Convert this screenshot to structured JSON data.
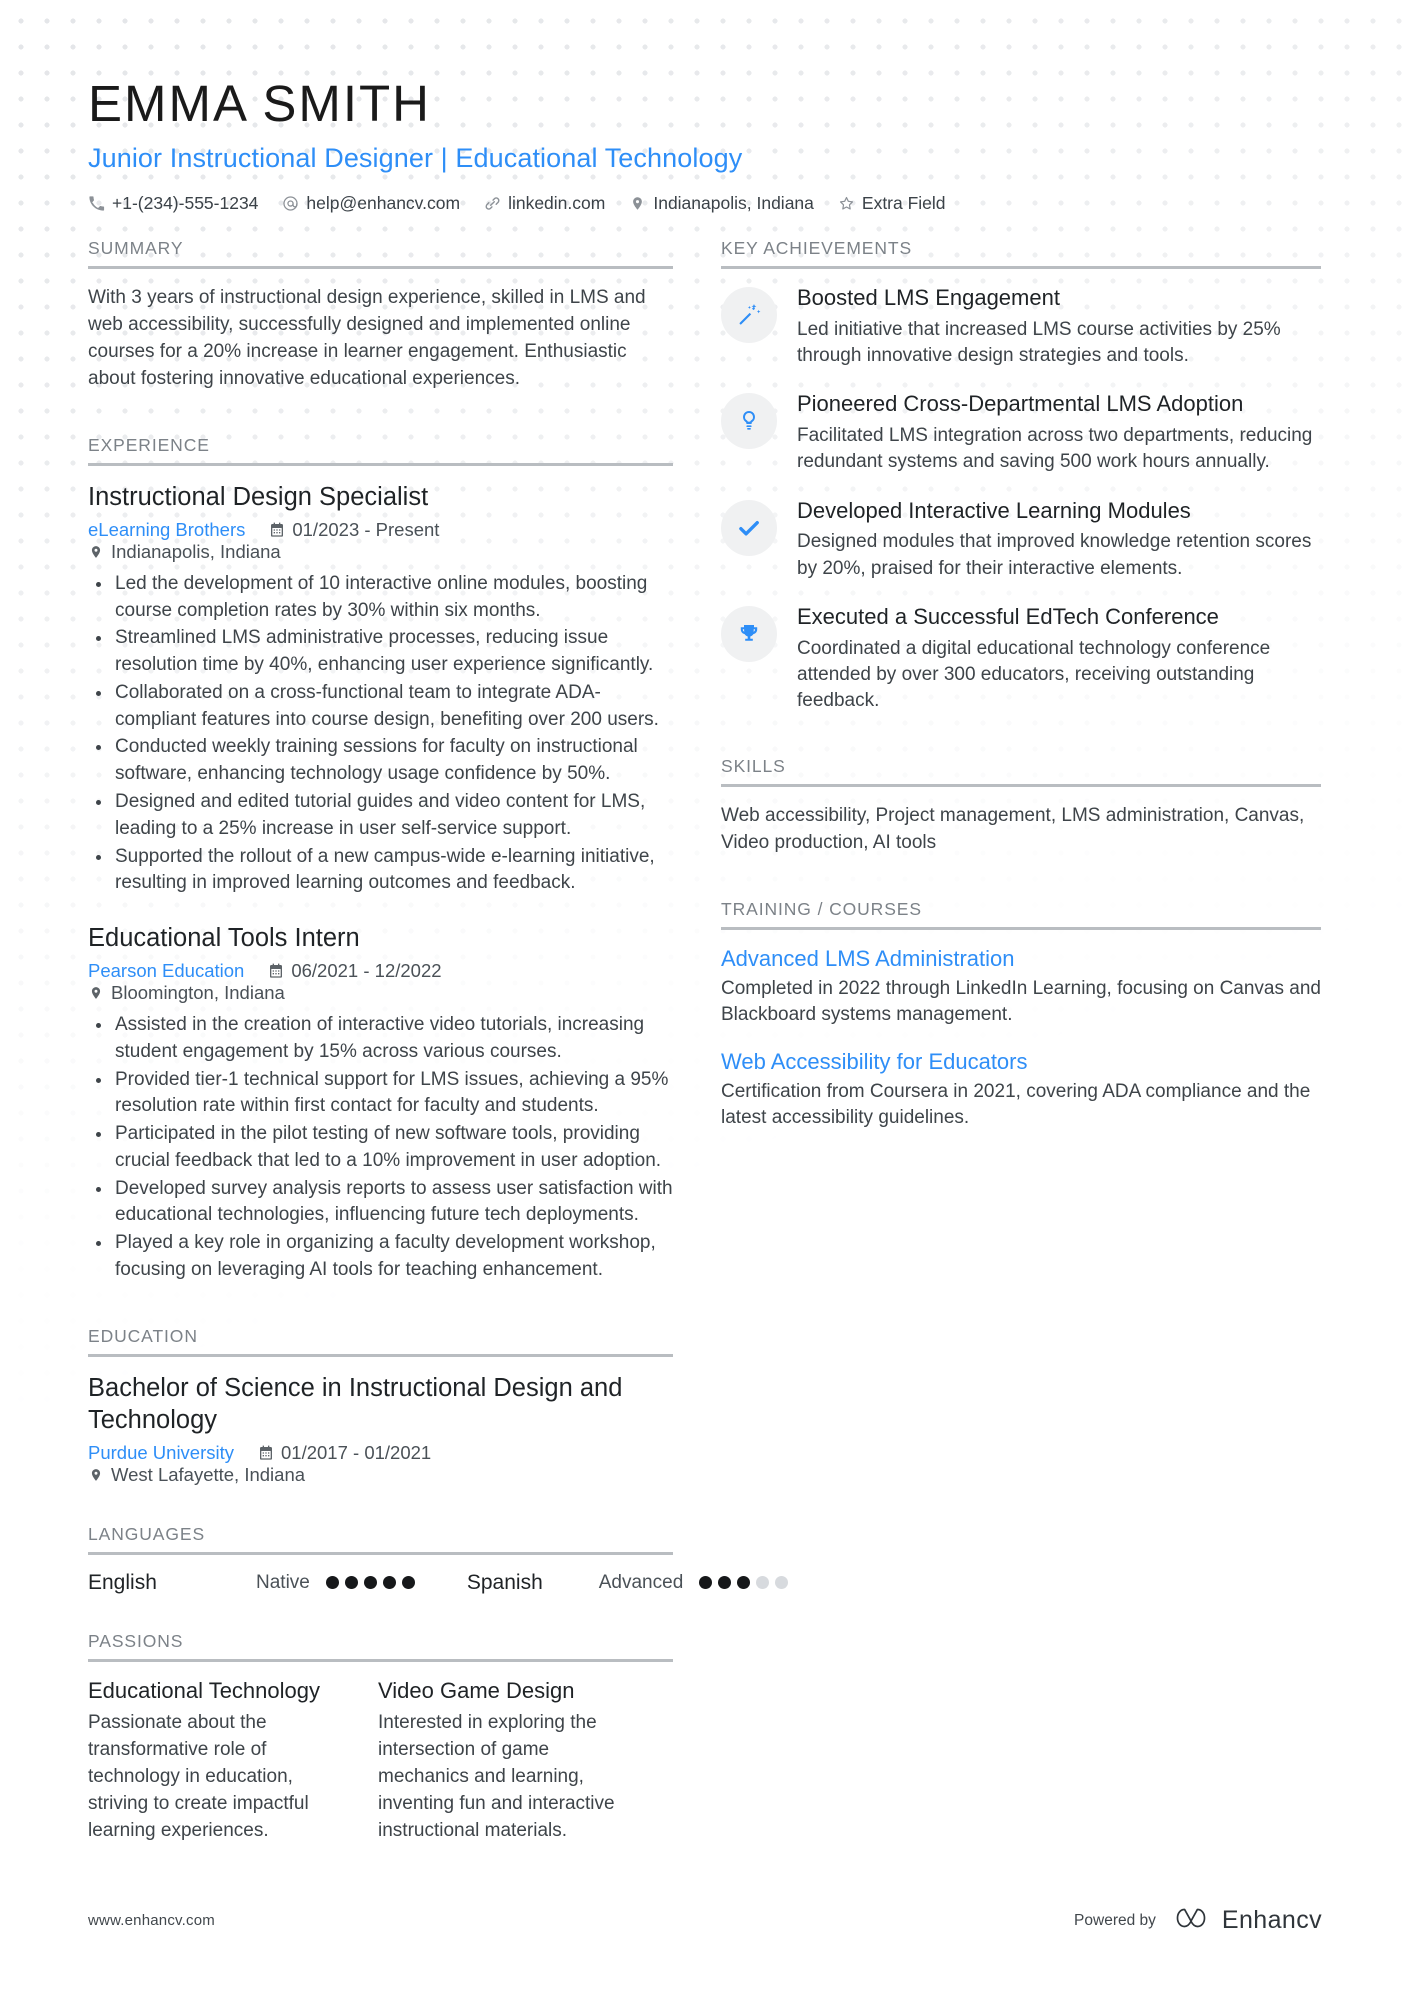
{
  "header": {
    "name": "EMMA SMITH",
    "headline": "Junior Instructional Designer | Educational Technology",
    "contacts": [
      {
        "icon": "phone-icon",
        "text": "+1-(234)-555-1234"
      },
      {
        "icon": "email-icon",
        "text": "help@enhancv.com"
      },
      {
        "icon": "link-icon",
        "text": "linkedin.com"
      },
      {
        "icon": "location-icon",
        "text": "Indianapolis, Indiana"
      },
      {
        "icon": "star-icon",
        "text": "Extra Field"
      }
    ]
  },
  "sections": {
    "summary": {
      "title": "SUMMARY",
      "text": "With 3 years of instructional design experience, skilled in LMS and web accessibility, successfully designed and implemented online courses for a 20% increase in learner engagement. Enthusiastic about fostering innovative educational experiences."
    },
    "experience": {
      "title": "EXPERIENCE",
      "entries": [
        {
          "role": "Instructional Design Specialist",
          "org": "eLearning Brothers",
          "dates": "01/2023 - Present",
          "location": "Indianapolis, Indiana",
          "bullets": [
            "Led the development of 10 interactive online modules, boosting course completion rates by 30% within six months.",
            "Streamlined LMS administrative processes, reducing issue resolution time by 40%, enhancing user experience significantly.",
            "Collaborated on a cross-functional team to integrate ADA-compliant features into course design, benefiting over 200 users.",
            "Conducted weekly training sessions for faculty on instructional software, enhancing technology usage confidence by 50%.",
            "Designed and edited tutorial guides and video content for LMS, leading to a 25% increase in user self-service support.",
            "Supported the rollout of a new campus-wide e-learning initiative, resulting in improved learning outcomes and feedback."
          ]
        },
        {
          "role": "Educational Tools Intern",
          "org": "Pearson Education",
          "dates": "06/2021 - 12/2022",
          "location": "Bloomington, Indiana",
          "bullets": [
            "Assisted in the creation of interactive video tutorials, increasing student engagement by 15% across various courses.",
            "Provided tier-1 technical support for LMS issues, achieving a 95% resolution rate within first contact for faculty and students.",
            "Participated in the pilot testing of new software tools, providing crucial feedback that led to a 10% improvement in user adoption.",
            "Developed survey analysis reports to assess user satisfaction with educational technologies, influencing future tech deployments.",
            "Played a key role in organizing a faculty development workshop, focusing on leveraging AI tools for teaching enhancement."
          ]
        }
      ]
    },
    "education": {
      "title": "EDUCATION",
      "entries": [
        {
          "degree": "Bachelor of Science in Instructional Design and Technology",
          "org": "Purdue University",
          "dates": "01/2017 - 01/2021",
          "location": "West Lafayette, Indiana"
        }
      ]
    },
    "languages": {
      "title": "LANGUAGES",
      "items": [
        {
          "name": "English",
          "level": "Native",
          "filled": 5,
          "total": 5
        },
        {
          "name": "Spanish",
          "level": "Advanced",
          "filled": 3,
          "total": 5
        }
      ]
    },
    "passions": {
      "title": "PASSIONS",
      "items": [
        {
          "name": "Educational Technology",
          "description": "Passionate about the transformative role of technology in education, striving to create impactful learning experiences."
        },
        {
          "name": "Video Game Design",
          "description": "Interested in exploring the intersection of game mechanics and learning, inventing fun and interactive instructional materials."
        }
      ]
    },
    "key_achievements": {
      "title": "KEY ACHIEVEMENTS",
      "items": [
        {
          "icon": "magic-wand-icon",
          "title": "Boosted LMS Engagement",
          "description": "Led initiative that increased LMS course activities by 25% through innovative design strategies and tools."
        },
        {
          "icon": "lightbulb-icon",
          "title": "Pioneered Cross-Departmental LMS Adoption",
          "description": "Facilitated LMS integration across two departments, reducing redundant systems and saving 500 work hours annually."
        },
        {
          "icon": "check-icon",
          "title": "Developed Interactive Learning Modules",
          "description": "Designed modules that improved knowledge retention scores by 20%, praised for their interactive elements."
        },
        {
          "icon": "trophy-icon",
          "title": "Executed a Successful EdTech Conference",
          "description": "Coordinated a digital educational technology conference attended by over 300 educators, receiving outstanding feedback."
        }
      ]
    },
    "skills": {
      "title": "SKILLS",
      "text": "Web accessibility, Project management, LMS administration, Canvas, Video production, AI tools"
    },
    "training": {
      "title": "TRAINING / COURSES",
      "items": [
        {
          "name": "Advanced LMS Administration",
          "description": "Completed in 2022 through LinkedIn Learning, focusing on Canvas and Blackboard systems management."
        },
        {
          "name": "Web Accessibility for Educators",
          "description": "Certification from Coursera in 2021, covering ADA compliance and the latest accessibility guidelines."
        }
      ]
    }
  },
  "footer": {
    "url": "www.enhancv.com",
    "powered_by": "Powered by",
    "brand": "Enhancv"
  },
  "colors": {
    "accent": "#2e8ef7",
    "heading": "#7c8288",
    "text": "#3e4449",
    "rule": "#b9bdc1"
  }
}
